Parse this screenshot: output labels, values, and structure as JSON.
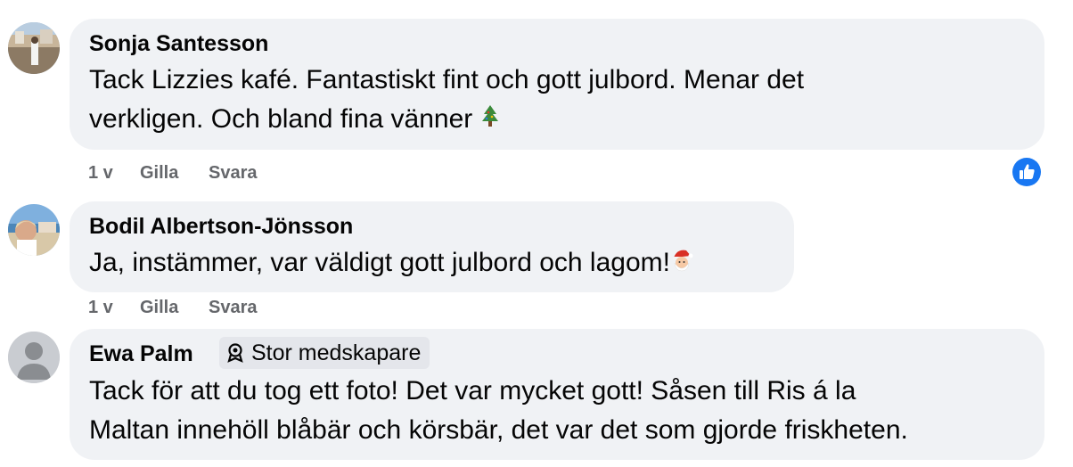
{
  "comments": [
    {
      "author": "Sonja Santesson",
      "line1": "Tack Lizzies kafé. Fantastiskt fint och gott julbord. Menar det",
      "line2": "verkligen. Och bland fina vänner",
      "emoji": "christmas-tree-icon",
      "time": "1 v",
      "like_label": "Gilla",
      "reply_label": "Svara",
      "reaction": "like-reaction-icon"
    },
    {
      "author": "Bodil Albertson-Jönsson",
      "line1": "Ja, instämmer, var väldigt gott julbord och lagom!",
      "emoji": "santa-claus-icon",
      "time": "1 v",
      "like_label": "Gilla",
      "reply_label": "Svara"
    },
    {
      "author": "Ewa Palm",
      "badge": "Stor medskapare",
      "line1": "Tack för att du tog ett foto! Det var mycket gott! Såsen till Ris á la",
      "line2": "Maltan innehöll blåbär och körsbär, det var det som gjorde friskheten."
    }
  ],
  "colors": {
    "bubble": "#f0f2f5",
    "meta_text": "#65676b",
    "like_blue": "#1877f2",
    "badge_bg": "#e4e6eb"
  }
}
